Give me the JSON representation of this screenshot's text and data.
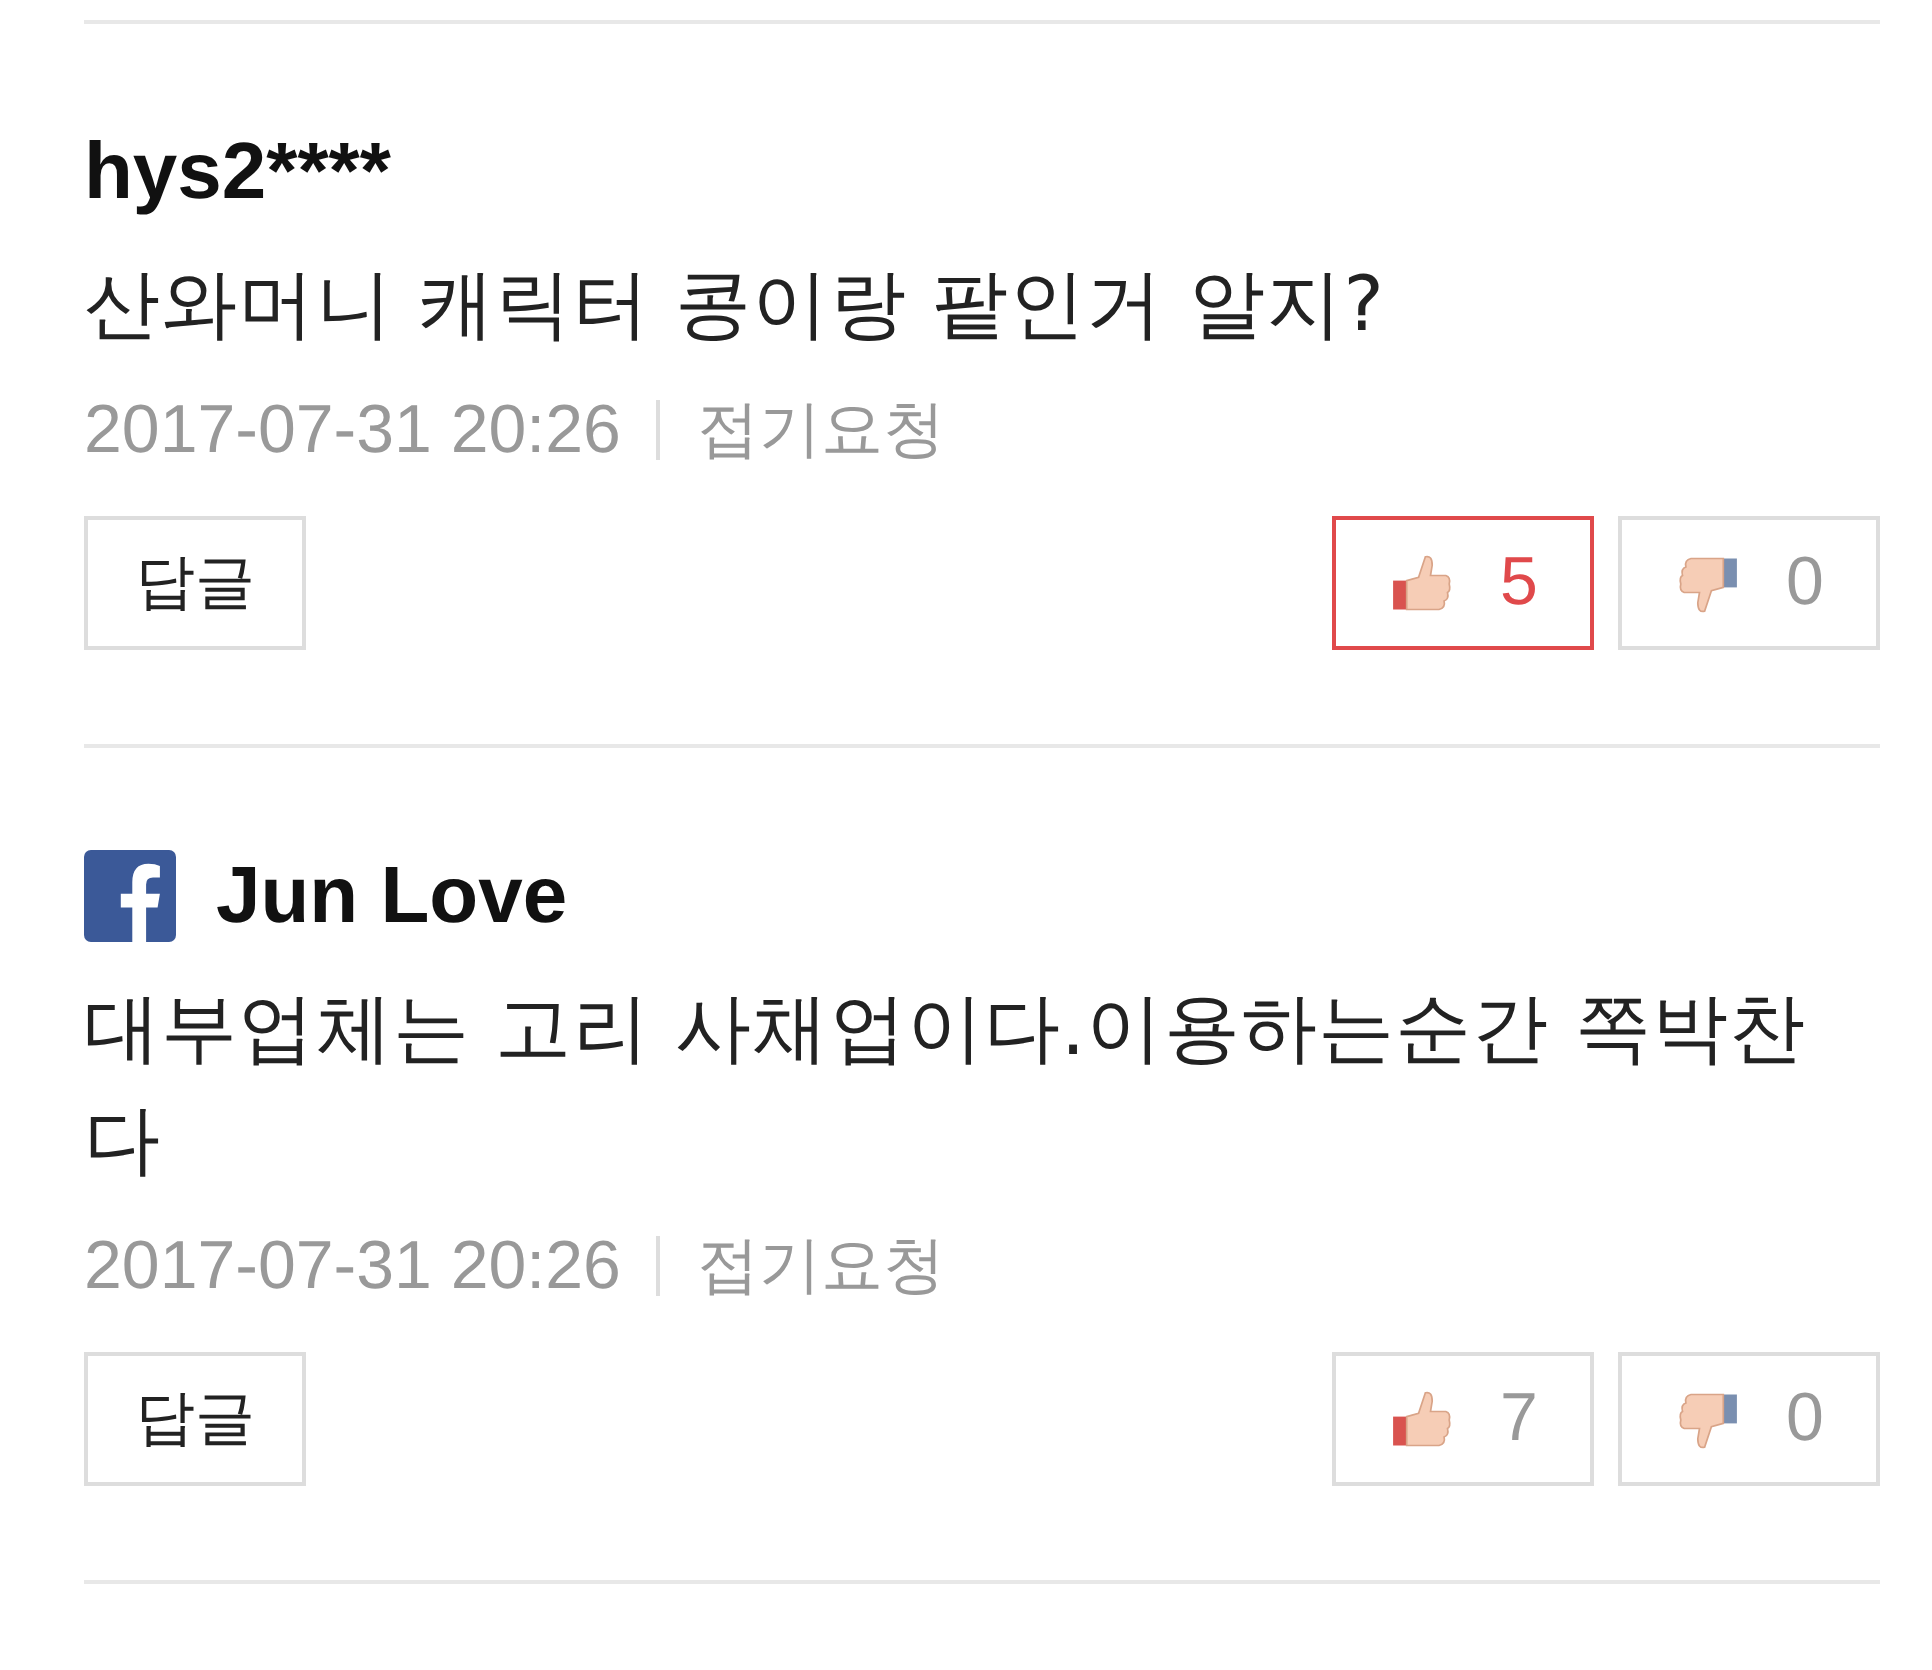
{
  "comments": [
    {
      "author": "hys2****",
      "facebook": false,
      "text": "산와머니 캐릭터 콩이랑 팥인거 알지?",
      "time": "2017-07-31 20:26",
      "report": "접기요청",
      "reply": "답글",
      "up": {
        "count": "5",
        "selected": true
      },
      "down": {
        "count": "0",
        "selected": false
      }
    },
    {
      "author": "Jun Love",
      "facebook": true,
      "text": "대부업체는 고리 사채업이다.이용하는순간 쪽박찬다",
      "time": "2017-07-31 20:26",
      "report": "접기요청",
      "reply": "답글",
      "up": {
        "count": "7",
        "selected": false
      },
      "down": {
        "count": "0",
        "selected": false
      }
    }
  ]
}
